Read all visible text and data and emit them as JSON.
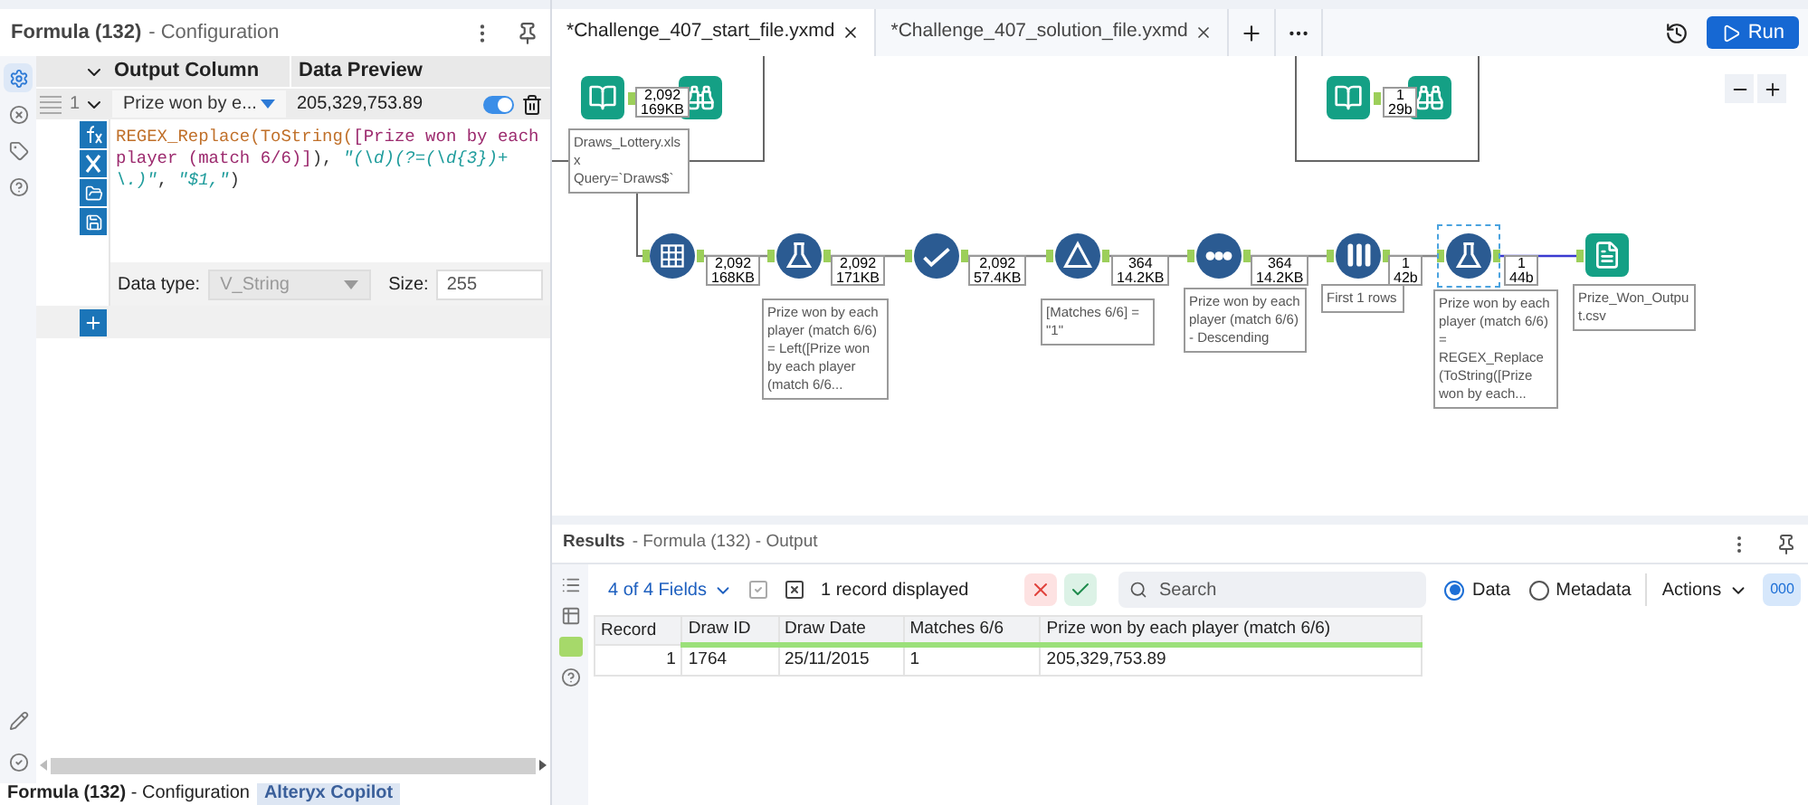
{
  "config_panel": {
    "title": "Formula (132)",
    "subtitle": "- Configuration",
    "rail": [
      {
        "selected": true
      },
      {
        "selected": false
      },
      {
        "selected": false
      },
      {
        "selected": false
      }
    ],
    "columns": [
      "Output Column",
      "Data Preview"
    ],
    "rows": [
      {
        "index": "1",
        "output_column": "Prize won by e...",
        "preview": "205,329,753.89",
        "enabled": true
      }
    ],
    "formula": [
      {
        "kind": "function",
        "text": "REGEX_Replace("
      },
      {
        "kind": "function",
        "text": "ToString("
      },
      {
        "kind": "field",
        "text": "[Prize won by each player (match 6/6)]"
      },
      {
        "kind": "punct",
        "text": "), "
      },
      {
        "kind": "string",
        "text": "\"(\\d)(?=(\\d{3})+\\.)\""
      },
      {
        "kind": "punct",
        "text": ", "
      },
      {
        "kind": "string",
        "text": "\"$1,\""
      },
      {
        "kind": "punct",
        "text": ")"
      }
    ],
    "data_type_label": "Data type:",
    "data_type": "V_String",
    "size_label": "Size:",
    "size": "255",
    "bottom_tabs": [
      {
        "label": "Formula (132)",
        "sublabel": "- Configuration",
        "selected": true
      },
      {
        "label": "Alteryx Copilot",
        "selected": false
      }
    ]
  },
  "doc_tabs": [
    {
      "label": "*Challenge_407_start_file.yxmd",
      "selected": true
    },
    {
      "label": "*Challenge_407_solution_file.yxmd",
      "selected": false
    }
  ],
  "run_button": "Run",
  "canvas": {
    "nodes": [
      {
        "kind": "input",
        "count": [
          "2,092",
          "169KB"
        ],
        "selected": false,
        "annotation": "Draws_Lottery.xlsx Query=`Draws$`"
      },
      {
        "kind": "browse",
        "selected": false
      },
      {
        "kind": "input",
        "count": [
          "1",
          "29b"
        ],
        "selected": false
      },
      {
        "kind": "browse",
        "selected": false
      },
      {
        "kind": "crosstab",
        "count": [
          "2,092",
          "168KB"
        ],
        "selected": false
      },
      {
        "kind": "formula",
        "count": [
          "2,092",
          "171KB"
        ],
        "selected": false,
        "annotation": "Prize won by each player (match 6/6) = Left([Prize won by each player (match 6/6..."
      },
      {
        "kind": "select",
        "count": [
          "2,092",
          "57.4KB"
        ],
        "selected": false
      },
      {
        "kind": "filter",
        "count": [
          "364",
          "14.2KB"
        ],
        "selected": false,
        "annotation": "[Matches 6/6] = \"1\""
      },
      {
        "kind": "sort",
        "count": [
          "364",
          "14.2KB"
        ],
        "selected": false,
        "annotation": "Prize won by each player (match 6/6) - Descending"
      },
      {
        "kind": "sample",
        "count": [
          "1",
          "42b"
        ],
        "selected": false,
        "annotation": "First 1 rows"
      },
      {
        "kind": "formula",
        "count": [
          "1",
          "44b"
        ],
        "selected": true,
        "annotation": "Prize won by each player (match 6/6) = REGEX_Replace (ToString([Prize won by each..."
      },
      {
        "kind": "output",
        "selected": false,
        "annotation": "Prize_Won_Output.csv"
      }
    ]
  },
  "results": {
    "title": "Results",
    "subtitle": "- Formula (132) - Output",
    "fields_menu": "4 of 4 Fields",
    "record_count": "1 record displayed",
    "search_placeholder": "Search",
    "views": [
      {
        "label": "Data",
        "selected": true
      },
      {
        "label": "Metadata",
        "selected": false
      }
    ],
    "actions": "Actions",
    "cell_button": "000",
    "columns": [
      "Record",
      "Draw ID",
      "Draw Date",
      "Matches 6/6",
      "Prize won by each player (match 6/6)"
    ],
    "rows": [
      [
        "1",
        "1764",
        "25/11/2015",
        "1",
        "205,329,753.89"
      ]
    ]
  }
}
